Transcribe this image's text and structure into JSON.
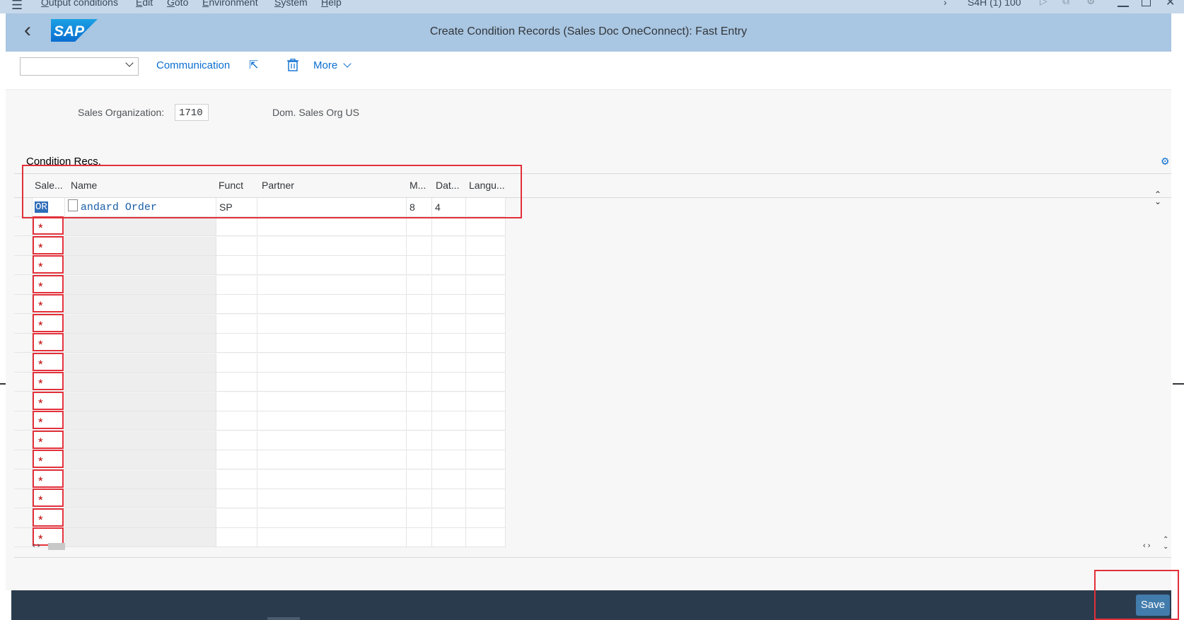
{
  "menubar": {
    "items": [
      "Output conditions",
      "Edit",
      "Goto",
      "Environment",
      "System",
      "Help"
    ],
    "system_info": "S4H (1) 100"
  },
  "shell": {
    "logo_text": "SAP",
    "title": "Create Condition Records (Sales Doc OneConnect): Fast Entry"
  },
  "toolbar": {
    "dropdown_value": "",
    "communication_label": "Communication",
    "more_label": "More"
  },
  "header_fields": {
    "sales_org_label": "Sales Organization:",
    "sales_org_value": "1710",
    "sales_org_desc": "Dom. Sales Org US"
  },
  "table": {
    "title": "Condition Recs.",
    "columns": [
      "Sale...",
      "Name",
      "Funct",
      "Partner",
      "M...",
      "Dat...",
      "Langu..."
    ],
    "first_row": {
      "sales_doc_type": "OR",
      "name": "andard Order",
      "function": "SP",
      "partner": "",
      "medium": "8",
      "date": "4",
      "language": ""
    },
    "empty_row_marker": "*"
  },
  "footer": {
    "save_label": "Save"
  },
  "colors": {
    "shell_bg": "#a9c6e2",
    "menubar_bg": "#c6d8ea",
    "accent": "#0a6ed1",
    "highlight_box": "#e2303a",
    "footer_bg": "#2a3b4d",
    "save_button_bg": "#427cac"
  }
}
